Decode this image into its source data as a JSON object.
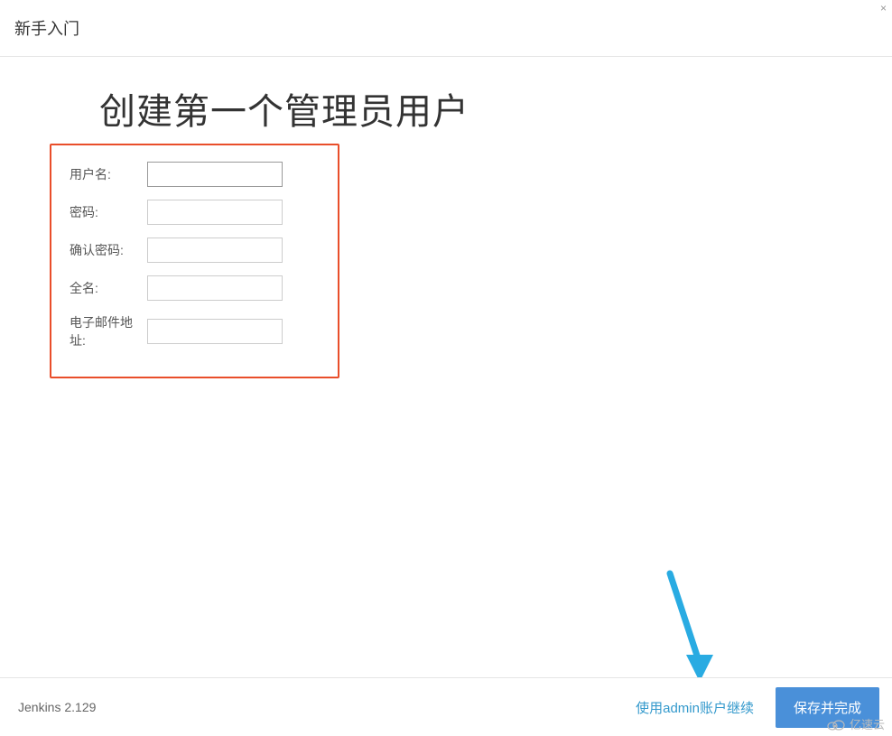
{
  "header": {
    "title": "新手入门"
  },
  "main": {
    "page_title": "创建第一个管理员用户",
    "form": {
      "username": {
        "label": "用户名:",
        "value": ""
      },
      "password": {
        "label": "密码:",
        "value": ""
      },
      "confirm_password": {
        "label": "确认密码:",
        "value": ""
      },
      "fullname": {
        "label": "全名:",
        "value": ""
      },
      "email": {
        "label": "电子邮件地址:",
        "value": ""
      }
    }
  },
  "footer": {
    "version": "Jenkins 2.129",
    "continue_as_admin": "使用admin账户继续",
    "save_and_finish": "保存并完成"
  },
  "watermark": {
    "text": "亿速云"
  },
  "close": "×"
}
